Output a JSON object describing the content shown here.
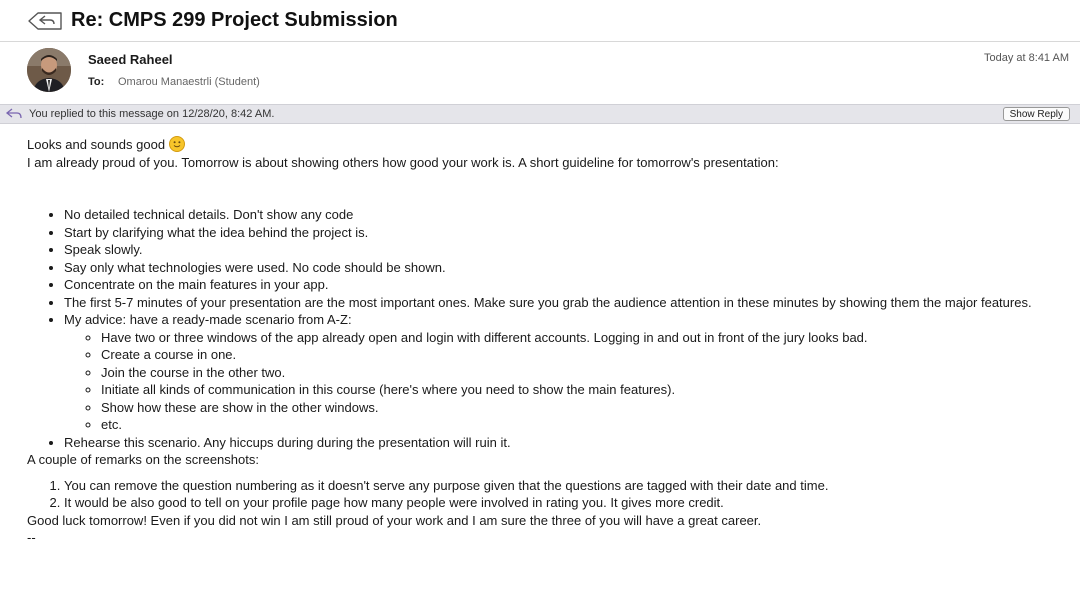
{
  "subject": "Re: CMPS 299 Project Submission",
  "sender": "Saeed Raheel",
  "date": "Today at 8:41 AM",
  "to_label": "To:",
  "to_value": "Omarou Manaestrli (Student)",
  "reply_banner": {
    "text": "You replied to this message on 12/28/20, 8:42 AM.",
    "button": "Show Reply"
  },
  "body": {
    "line1": "Looks and sounds good",
    "line2": "I am already proud of you. Tomorrow is about showing others how good your work is. A short guideline for tomorrow's presentation:",
    "bullets": [
      "No detailed technical details. Don't show any code",
      "Start by clarifying what the idea behind the project is.",
      "Speak slowly.",
      "Say only what technologies were used. No code should be shown.",
      "Concentrate on the main features in your app.",
      "The first 5-7 minutes of your presentation are the most important ones. Make sure you grab the audience attention in these minutes by showing them the major features.",
      "My advice: have a ready-made scenario from A-Z:"
    ],
    "sub_bullets": [
      "Have two or three windows of the app already open and login with different accounts. Logging in and out in front of the jury looks bad.",
      "Create a course in one.",
      "Join the course in the other two.",
      "Initiate all kinds of communication in this course (here's where you need to show the main features).",
      "Show how these are show in the other windows.",
      "etc."
    ],
    "last_bullet": "Rehearse this scenario. Any hiccups during during the presentation will ruin it.",
    "remarks_intro": "A couple of remarks on the screenshots:",
    "remarks": [
      "You can remove the question numbering as it doesn't serve any purpose given that the questions are tagged with their date and time.",
      "It would be also good to tell on your profile page how many people were involved in rating you. It gives more credit."
    ],
    "closing": "Good luck tomorrow! Even if you did not win I am still proud of your work and I am sure the three of you will have a great career.",
    "signature": "--"
  }
}
